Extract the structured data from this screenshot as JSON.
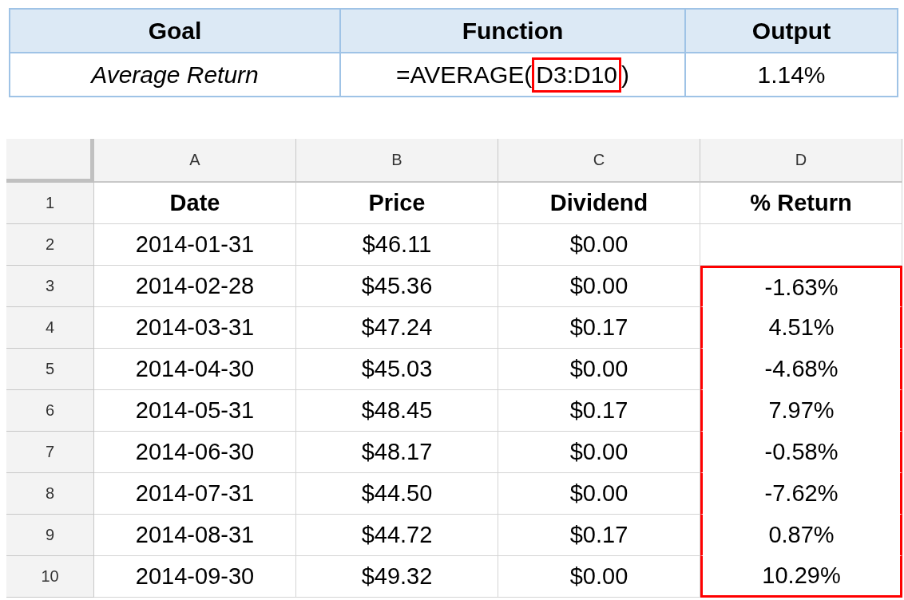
{
  "summary": {
    "columns": [
      "Goal",
      "Function",
      "Output"
    ],
    "row": {
      "goal": "Average Return",
      "function_parts": [
        {
          "text": "=AVERAGE(",
          "highlighted": false
        },
        {
          "text": "D3:D10",
          "highlighted": true
        },
        {
          "text": ")",
          "highlighted": false
        }
      ],
      "output": "1.14%"
    }
  },
  "sheet": {
    "column_letters": [
      "A",
      "B",
      "C",
      "D"
    ],
    "rows": [
      {
        "number": "1",
        "kind": "header",
        "cells": [
          "Date",
          "Price",
          "Dividend",
          "% Return"
        ],
        "return_highlighted": false
      },
      {
        "number": "2",
        "kind": "data",
        "cells": [
          "2014-01-31",
          "$46.11",
          "$0.00",
          ""
        ],
        "return_highlighted": false
      },
      {
        "number": "3",
        "kind": "data",
        "cells": [
          "2014-02-28",
          "$45.36",
          "$0.00",
          "-1.63%"
        ],
        "return_highlighted": true
      },
      {
        "number": "4",
        "kind": "data",
        "cells": [
          "2014-03-31",
          "$47.24",
          "$0.17",
          "4.51%"
        ],
        "return_highlighted": true
      },
      {
        "number": "5",
        "kind": "data",
        "cells": [
          "2014-04-30",
          "$45.03",
          "$0.00",
          "-4.68%"
        ],
        "return_highlighted": true
      },
      {
        "number": "6",
        "kind": "data",
        "cells": [
          "2014-05-31",
          "$48.45",
          "$0.17",
          "7.97%"
        ],
        "return_highlighted": true
      },
      {
        "number": "7",
        "kind": "data",
        "cells": [
          "2014-06-30",
          "$48.17",
          "$0.00",
          "-0.58%"
        ],
        "return_highlighted": true
      },
      {
        "number": "8",
        "kind": "data",
        "cells": [
          "2014-07-31",
          "$44.50",
          "$0.00",
          "-7.62%"
        ],
        "return_highlighted": true
      },
      {
        "number": "9",
        "kind": "data",
        "cells": [
          "2014-08-31",
          "$44.72",
          "$0.17",
          "0.87%"
        ],
        "return_highlighted": true
      },
      {
        "number": "10",
        "kind": "data",
        "cells": [
          "2014-09-30",
          "$49.32",
          "$0.00",
          "10.29%"
        ],
        "return_highlighted": true
      }
    ]
  }
}
